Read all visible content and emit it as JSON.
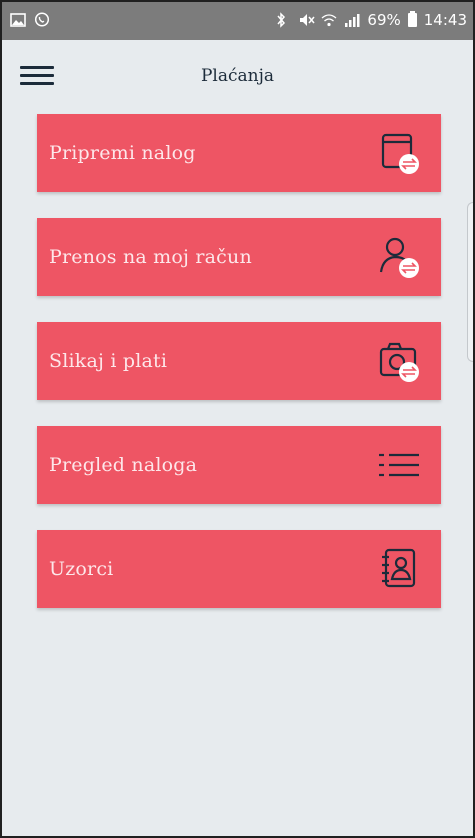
{
  "status_bar": {
    "battery_pct": "69%",
    "time": "14:43",
    "icons": [
      "gallery-icon",
      "viber-icon",
      "bluetooth-icon",
      "mute-icon",
      "wifi-icon",
      "signal-icon",
      "battery-icon"
    ]
  },
  "header": {
    "title": "Plaćanja",
    "menu_icon": "hamburger-menu-icon"
  },
  "colors": {
    "card_bg": "#ee5564",
    "card_text": "#fde7ea",
    "page_bg": "#e7ebee",
    "icon_stroke": "#1c2b3a"
  },
  "menu": [
    {
      "label": "Pripremi nalog",
      "icon": "prepare-order-icon"
    },
    {
      "label": "Prenos na moj račun",
      "icon": "transfer-own-account-icon"
    },
    {
      "label": "Slikaj i plati",
      "icon": "scan-and-pay-icon"
    },
    {
      "label": "Pregled naloga",
      "icon": "order-list-icon"
    },
    {
      "label": "Uzorci",
      "icon": "templates-icon"
    }
  ]
}
